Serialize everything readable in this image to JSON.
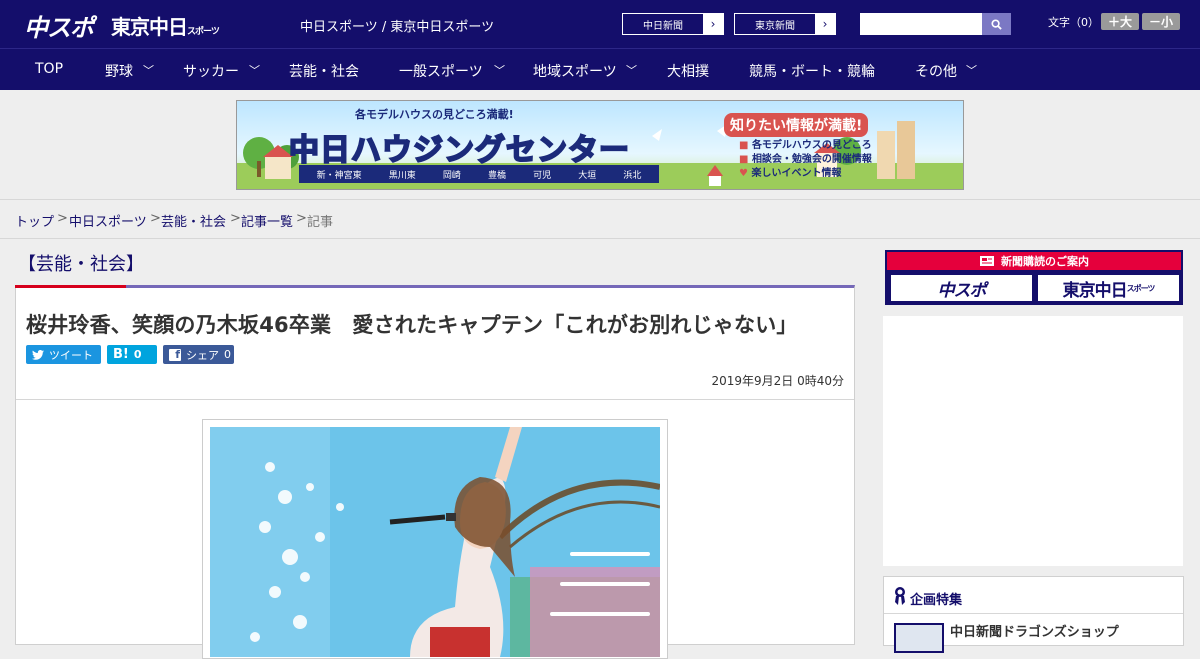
{
  "header": {
    "logo_main": "中スポ",
    "logo_sub": "東京中日",
    "logo_sub_small": "スポーツ",
    "site_title": "中日スポーツ / 東京中日スポーツ",
    "paper_buttons": [
      "中日新聞",
      "東京新聞"
    ],
    "font_size_label": "文字（0）",
    "font_bigger": "＋大",
    "font_smaller": "－小"
  },
  "nav": {
    "items": [
      "TOP",
      "野球",
      "サッカー",
      "芸能・社会",
      "一般スポーツ",
      "地域スポーツ",
      "大相撲",
      "競馬・ボート・競輪",
      "その他"
    ]
  },
  "banner": {
    "top_text": "各モデルハウスの見どころ満載!",
    "title": "中日ハウジングセンター",
    "locations": [
      "新・神宮東",
      "黒川東",
      "岡崎",
      "豊橋",
      "可児",
      "大垣",
      "浜北"
    ],
    "right_title": "知りたい情報が満載!",
    "right_items": [
      "各モデルハウスの見どころ",
      "相談会・勉強会の開催情報",
      "楽しいイベント情報"
    ]
  },
  "breadcrumb": {
    "items": [
      "トップ",
      "中日スポーツ",
      "芸能・社会",
      "記事一覧"
    ],
    "separator": ">",
    "current": "記事"
  },
  "article": {
    "category": "【芸能・社会】",
    "headline": "桜井玲香、笑顔の乃木坂46卒業　愛されたキャプテン「これがお別れじゃない」",
    "share": {
      "tweet_label": "ツイート",
      "hatena_label": "B!",
      "hatena_count": "0",
      "fb_label": "シェア",
      "fb_count": "0"
    },
    "date": "2019年9月2日 0時40分"
  },
  "sidebar": {
    "subscribe_heading": "新聞購読のご案内",
    "subscribe_logos": [
      "中スポ",
      "東京中日"
    ],
    "subscribe_logo_small": "スポーツ",
    "feature_title": "企画特集",
    "feature_item": "中日新聞ドラゴンズショップ"
  },
  "colors": {
    "brand_navy": "#140e6b",
    "accent_red": "#d6001c",
    "twitter_blue": "#1b95e0",
    "hatena_blue": "#00a4de",
    "facebook_blue": "#3b5998"
  }
}
